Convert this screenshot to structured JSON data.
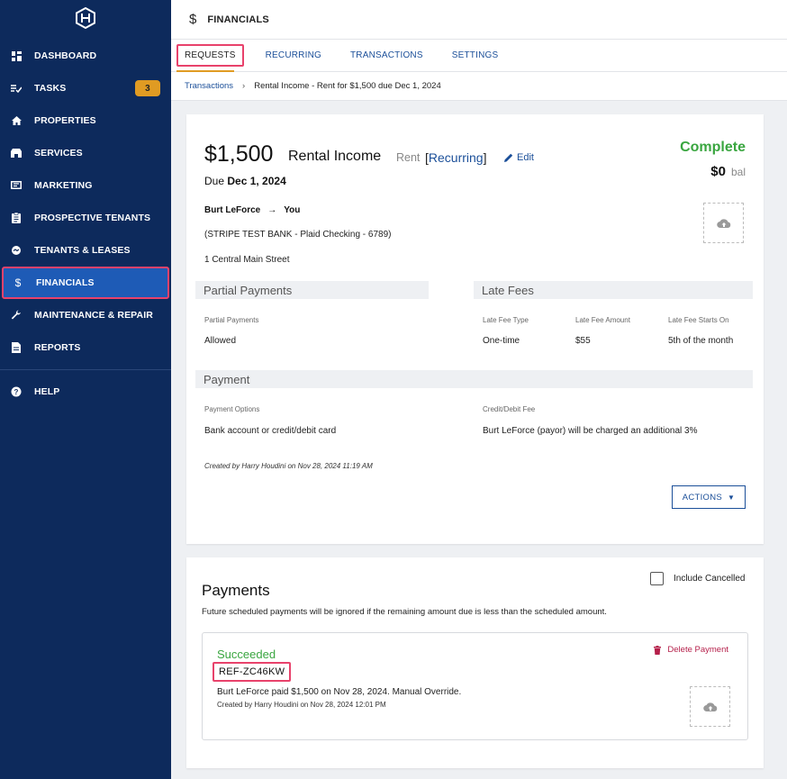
{
  "sidebar": {
    "items": [
      {
        "label": "DASHBOARD",
        "icon": "dashboard-icon"
      },
      {
        "label": "TASKS",
        "icon": "tasks-icon",
        "badge": "3"
      },
      {
        "label": "PROPERTIES",
        "icon": "home-icon"
      },
      {
        "label": "SERVICES",
        "icon": "store-icon"
      },
      {
        "label": "MARKETING",
        "icon": "billboard-icon"
      },
      {
        "label": "PROSPECTIVE TENANTS",
        "icon": "clipboard-icon"
      },
      {
        "label": "TENANTS & LEASES",
        "icon": "handshake-icon"
      },
      {
        "label": "FINANCIALS",
        "icon": "dollar-icon"
      },
      {
        "label": "MAINTENANCE & REPAIR",
        "icon": "wrench-icon"
      },
      {
        "label": "REPORTS",
        "icon": "report-icon"
      },
      {
        "label": "HELP",
        "icon": "help-icon"
      }
    ]
  },
  "header": {
    "icon_glyph": "$",
    "title": "FINANCIALS"
  },
  "tabs": [
    {
      "label": "REQUESTS"
    },
    {
      "label": "RECURRING"
    },
    {
      "label": "TRANSACTIONS"
    },
    {
      "label": "SETTINGS"
    }
  ],
  "breadcrumb": {
    "root": "Transactions",
    "sep": "›",
    "current": "Rental Income - Rent for $1,500 due Dec 1, 2024"
  },
  "request": {
    "amount": "$1,500",
    "type": "Rental Income",
    "category": "Rent",
    "recurring_open": "[",
    "recurring": "Recurring",
    "recurring_close": "]",
    "edit": "Edit",
    "due_prefix": "Due",
    "due_date": "Dec 1, 2024",
    "status": "Complete",
    "balance": "$0",
    "balance_label": "bal",
    "payer": "Burt LeForce",
    "arrow": "→",
    "payee": "You",
    "bank": "(STRIPE TEST BANK - Plaid Checking - 6789)",
    "address": "1 Central Main Street",
    "partial": {
      "heading": "Partial Payments",
      "label": "Partial Payments",
      "value": "Allowed"
    },
    "late_fees": {
      "heading": "Late Fees",
      "type_label": "Late Fee Type",
      "type_value": "One-time",
      "amount_label": "Late Fee Amount",
      "amount_value": "$55",
      "starts_label": "Late Fee Starts On",
      "starts_value": "5th of the month"
    },
    "payment": {
      "heading": "Payment",
      "options_label": "Payment Options",
      "options_value": "Bank account or credit/debit card",
      "fee_label": "Credit/Debit Fee",
      "fee_value": "Burt LeForce (payor) will be charged an additional 3%"
    },
    "created": "Created by Harry Houdini on Nov 28, 2024 11:19 AM",
    "actions": "ACTIONS"
  },
  "payments": {
    "title": "Payments",
    "include_cancelled": "Include Cancelled",
    "include_cancelled_checked": false,
    "note": "Future scheduled payments will be ignored if the remaining amount due is less than the scheduled amount.",
    "items": [
      {
        "status": "Succeeded",
        "ref": "REF-ZC46KW",
        "description": "Burt LeForce paid $1,500 on Nov 28, 2024. Manual Override.",
        "created": "Created by Harry Houdini on Nov 28, 2024 12:01 PM",
        "delete": "Delete Payment"
      }
    ]
  },
  "colors": {
    "sidebar_bg": "#0d2a5c",
    "active_nav": "#1e5bb6",
    "highlight": "#e8426b",
    "success": "#3aa640",
    "link": "#1b4f99",
    "danger": "#b51f4a",
    "badge": "#e09b23"
  }
}
